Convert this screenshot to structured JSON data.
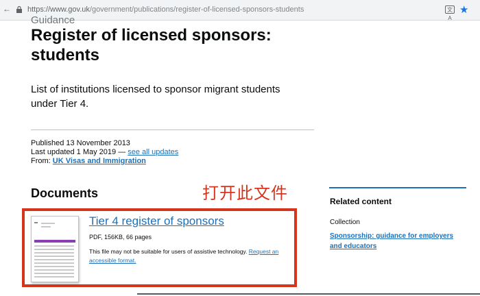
{
  "browser": {
    "url_host": "https://www.gov.uk",
    "url_path": "/government/publications/register-of-licensed-sponsors-students",
    "translate_icon_text": "文A",
    "colors": {
      "star": "#1a73e8"
    }
  },
  "page": {
    "kicker": "Guidance",
    "title": "Register of licensed sponsors: students",
    "summary": "List of institutions licensed to sponsor migrant students under Tier 4.",
    "meta": {
      "published": "Published 13 November 2013",
      "last_updated": "Last updated 1 May 2019 — ",
      "see_updates": "see all updates",
      "from_label": "From: ",
      "from_link": "UK Visas and Immigration"
    },
    "documents_heading": "Documents",
    "annotation": "打开此文件",
    "document": {
      "link": "Tier 4 register of sponsors",
      "meta": "PDF, 156KB, 66 pages",
      "note": "This file may not be suitable for users of assistive technology. ",
      "request_link": "Request an accessible format."
    },
    "related": {
      "heading": "Related content",
      "collection_label": "Collection",
      "link": "Sponsorship: guidance for employers and educators"
    }
  },
  "colors": {
    "link": "#1d70b8",
    "highlight": "#d4351c",
    "text": "#0b0c0c"
  }
}
